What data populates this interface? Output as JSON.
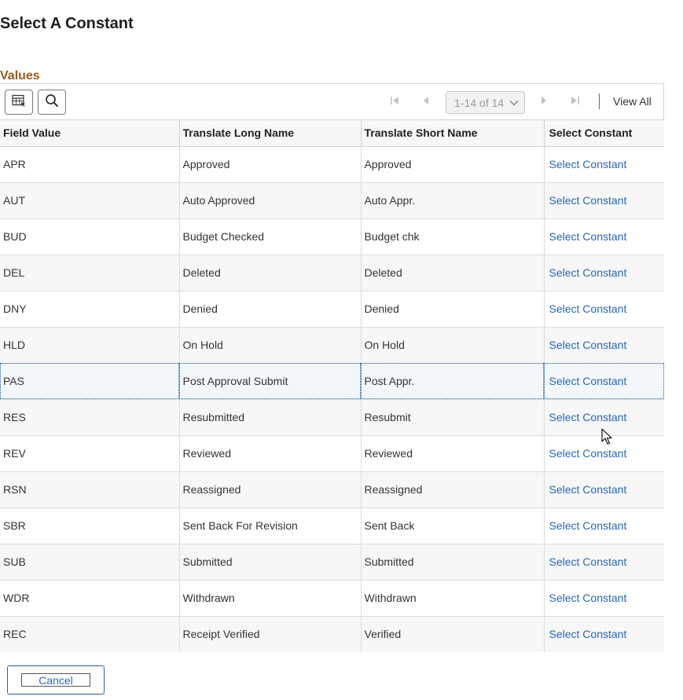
{
  "page": {
    "title": "Select A Constant"
  },
  "grid": {
    "title": "Values",
    "pagination": {
      "range_label": "1-14 of 14",
      "view_all_label": "View All"
    },
    "columns": [
      "Field Value",
      "Translate Long Name",
      "Translate Short Name",
      "Select Constant"
    ],
    "rows": [
      {
        "field_value": "APR",
        "long_name": "Approved",
        "short_name": "Approved",
        "action": "Select Constant"
      },
      {
        "field_value": "AUT",
        "long_name": "Auto Approved",
        "short_name": "Auto Appr.",
        "action": "Select Constant"
      },
      {
        "field_value": "BUD",
        "long_name": "Budget Checked",
        "short_name": "Budget chk",
        "action": "Select Constant"
      },
      {
        "field_value": "DEL",
        "long_name": "Deleted",
        "short_name": "Deleted",
        "action": "Select Constant"
      },
      {
        "field_value": "DNY",
        "long_name": "Denied",
        "short_name": "Denied",
        "action": "Select Constant"
      },
      {
        "field_value": "HLD",
        "long_name": "On Hold",
        "short_name": "On Hold",
        "action": "Select Constant"
      },
      {
        "field_value": "PAS",
        "long_name": "Post Approval Submit",
        "short_name": "Post Appr.",
        "action": "Select Constant"
      },
      {
        "field_value": "RES",
        "long_name": "Resubmitted",
        "short_name": "Resubmit",
        "action": "Select Constant"
      },
      {
        "field_value": "REV",
        "long_name": "Reviewed",
        "short_name": "Reviewed",
        "action": "Select Constant"
      },
      {
        "field_value": "RSN",
        "long_name": "Reassigned",
        "short_name": "Reassigned",
        "action": "Select Constant"
      },
      {
        "field_value": "SBR",
        "long_name": "Sent Back For Revision",
        "short_name": "Sent Back",
        "action": "Select Constant"
      },
      {
        "field_value": "SUB",
        "long_name": "Submitted",
        "short_name": "Submitted",
        "action": "Select Constant"
      },
      {
        "field_value": "WDR",
        "long_name": "Withdrawn",
        "short_name": "Withdrawn",
        "action": "Select Constant"
      },
      {
        "field_value": "REC",
        "long_name": "Receipt Verified",
        "short_name": "Verified",
        "action": "Select Constant"
      }
    ],
    "selected_row": 6
  },
  "footer": {
    "cancel_label": "Cancel"
  },
  "colors": {
    "accent_link": "#2866b7",
    "grid_title": "#9a5b1e"
  },
  "icons": {
    "toolbar": [
      "personalize-grid-icon",
      "search-icon"
    ],
    "pagination": [
      "first-page-icon",
      "previous-page-icon",
      "chevron-down-icon",
      "next-page-icon",
      "last-page-icon"
    ]
  }
}
